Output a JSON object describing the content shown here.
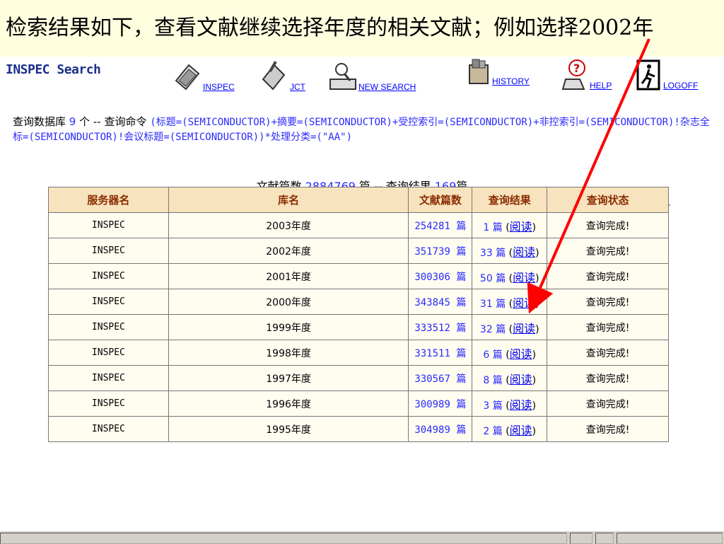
{
  "slide": {
    "title": "检索结果如下，查看文献继续选择年度的相关文献；例如选择2002年"
  },
  "header": {
    "logo": "INSPEC Search",
    "nav": [
      {
        "label": "INSPEC"
      },
      {
        "label": "JCT"
      },
      {
        "label": "NEW SEARCH"
      },
      {
        "label": "HISTORY"
      },
      {
        "label": "HELP"
      },
      {
        "label": "LOGOFF"
      }
    ]
  },
  "query": {
    "prefix1": "查询数据库",
    "db_count": "9",
    "prefix2": "个 -- 查询命令",
    "command": "(标题=(SEMICONDUCTOR)+摘要=(SEMICONDUCTOR)+受控索引=(SEMICONDUCTOR)+非控索引=(SEMICONDUCTOR)!杂志全标=(SEMICONDUCTOR)!会议标题=(SEMICONDUCTOR))*处理分类=(\"AA\")"
  },
  "summary": {
    "label1": "文献篇数",
    "total": "2884769",
    "label2": "篇 -- 查询结果",
    "found": "169",
    "label3": "篇"
  },
  "table": {
    "headers": [
      "服务器名",
      "库名",
      "文献篇数",
      "查询结果",
      "查询状态"
    ],
    "unit": "篇",
    "read_label": "阅读",
    "rows": [
      {
        "server": "INSPEC",
        "db": "2003年度",
        "docs": "254281",
        "results": "1",
        "status": "查询完成!"
      },
      {
        "server": "INSPEC",
        "db": "2002年度",
        "docs": "351739",
        "results": "33",
        "status": "查询完成!"
      },
      {
        "server": "INSPEC",
        "db": "2001年度",
        "docs": "300306",
        "results": "50",
        "status": "查询完成!"
      },
      {
        "server": "INSPEC",
        "db": "2000年度",
        "docs": "343845",
        "results": "31",
        "status": "查询完成!"
      },
      {
        "server": "INSPEC",
        "db": "1999年度",
        "docs": "333512",
        "results": "32",
        "status": "查询完成!"
      },
      {
        "server": "INSPEC",
        "db": "1998年度",
        "docs": "331511",
        "results": "6",
        "status": "查询完成!"
      },
      {
        "server": "INSPEC",
        "db": "1997年度",
        "docs": "330567",
        "results": "8",
        "status": "查询完成!"
      },
      {
        "server": "INSPEC",
        "db": "1996年度",
        "docs": "300989",
        "results": "3",
        "status": "查询完成!"
      },
      {
        "server": "INSPEC",
        "db": "1995年度",
        "docs": "304989",
        "results": "2",
        "status": "查询完成!"
      }
    ]
  },
  "colors": {
    "arrow": "#ff0000",
    "header_bg": "#f7e3bd",
    "link": "#2a2aff"
  }
}
